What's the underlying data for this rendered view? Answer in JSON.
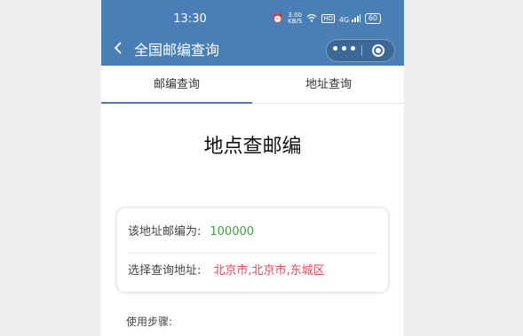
{
  "status_bar": {
    "time": "13:30",
    "speed_value": "3.00",
    "speed_unit": "KB/S",
    "hd_label": "HD",
    "signal_label": "4G",
    "battery": "60"
  },
  "navbar": {
    "title": "全国邮编查询",
    "more_label": "•••"
  },
  "tabs": [
    {
      "label": "邮编查询",
      "active": true
    },
    {
      "label": "地址查询",
      "active": false
    }
  ],
  "main": {
    "heading": "地点查邮编",
    "result": {
      "postcode_label": "该地址邮编为:",
      "postcode_value": "100000",
      "address_label": "选择查询地址:",
      "address_value": "北京市,北京市,东城区"
    },
    "steps_label": "使用步骤:"
  },
  "colors": {
    "accent": "#4a7fb6",
    "postcode_value": "#3aa63a",
    "address_value": "#d84b5a"
  }
}
